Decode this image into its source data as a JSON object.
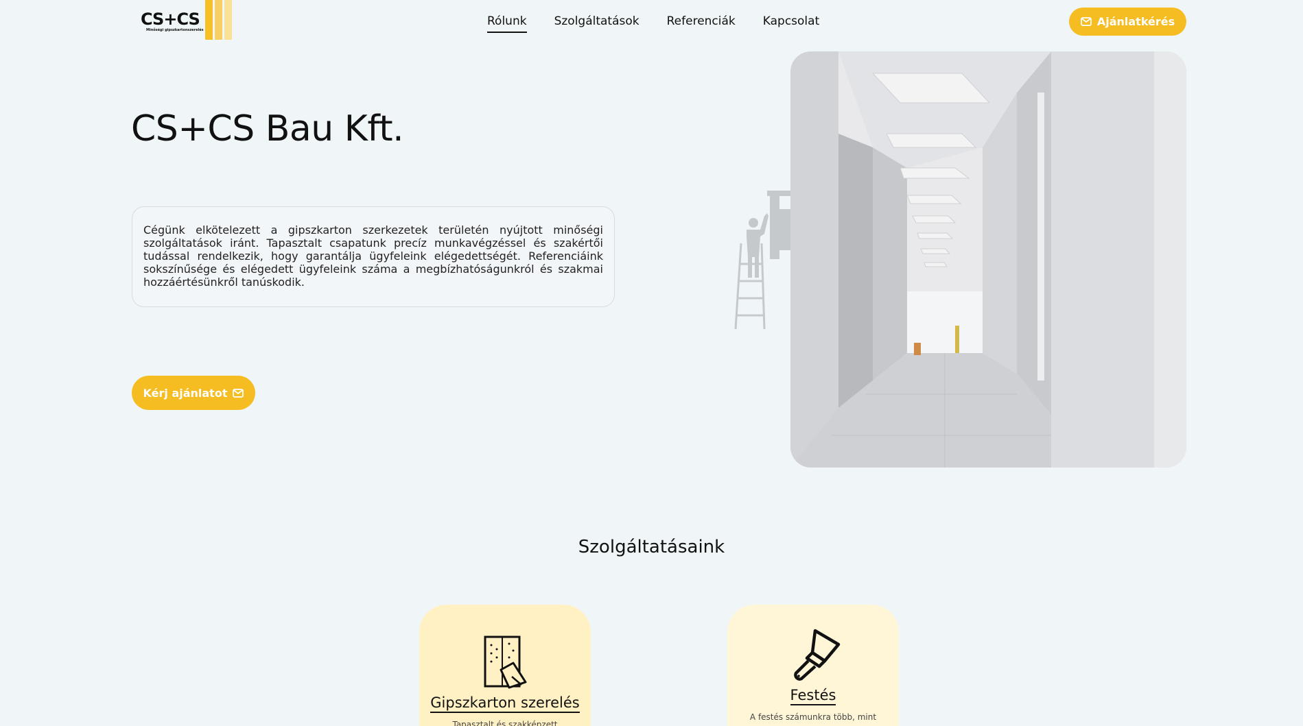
{
  "header": {
    "logo_main": "CS+CS",
    "logo_sub": "Minőségi gipszkartonszerelés",
    "nav": [
      {
        "label": "Rólunk",
        "active": true
      },
      {
        "label": "Szolgáltatások",
        "active": false
      },
      {
        "label": "Referenciák",
        "active": false
      },
      {
        "label": "Kapcsolat",
        "active": false
      }
    ],
    "quote_button": "Ajánlatkérés"
  },
  "hero": {
    "title": "CS+CS Bau Kft.",
    "description": "Cégünk elkötelezett a gipszkarton szerkezetek területén nyújtott minőségi szolgáltatások iránt. Tapasztalt csapatunk precíz munkavégzéssel és szakértői tudással rendelkezik, hogy garantálja ügyfeleink elégedettségét. Referenciáink sokszínűsége és elégedett ügyfeleink száma a megbízhatóságunkról és szakmai hozzáértésünkről tanúskodik.",
    "cta_button": "Kérj ajánlatot"
  },
  "services": {
    "title": "Szolgáltatásaink",
    "items": [
      {
        "name": "Gipszkarton szerelés",
        "desc": "Tapasztalt és szakképzett",
        "icon": "drywall-icon"
      },
      {
        "name": "Festés",
        "desc": "A festés számunkra több, mint",
        "icon": "paint-brush-icon"
      }
    ]
  },
  "colors": {
    "accent": "#f5bd21",
    "background": "#f0f5f7",
    "card": "#fff1c3"
  }
}
